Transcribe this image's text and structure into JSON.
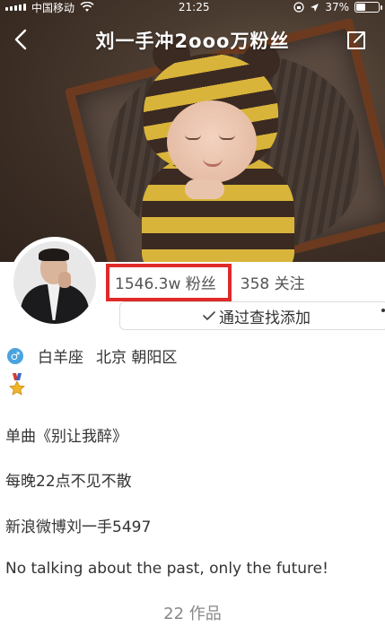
{
  "status_bar": {
    "carrier": "中国移动",
    "time": "21:25",
    "battery_percent": "37%",
    "battery_level": 0.37
  },
  "navbar": {
    "title": "刘一手冲2ooo万粉丝",
    "back_icon": "chevron-left-icon",
    "share_icon": "share-icon"
  },
  "profile": {
    "fans": "1546.3w 粉丝",
    "following": "358 关注",
    "add_button_label": "通过查找添加",
    "gender_icon": "male-icon",
    "gender_symbol": "♂",
    "zodiac": "白羊座",
    "location": "北京 朝阳区",
    "badge_icon": "medal-icon",
    "bio_lines": [
      "单曲《别让我醉》",
      "每晚22点不见不散",
      "新浪微博刘一手5497",
      "No talking about the past, only the future!"
    ],
    "works": "22 作品"
  },
  "colors": {
    "highlight_box": "#e02a2a",
    "male_badge": "#4aa3df"
  }
}
